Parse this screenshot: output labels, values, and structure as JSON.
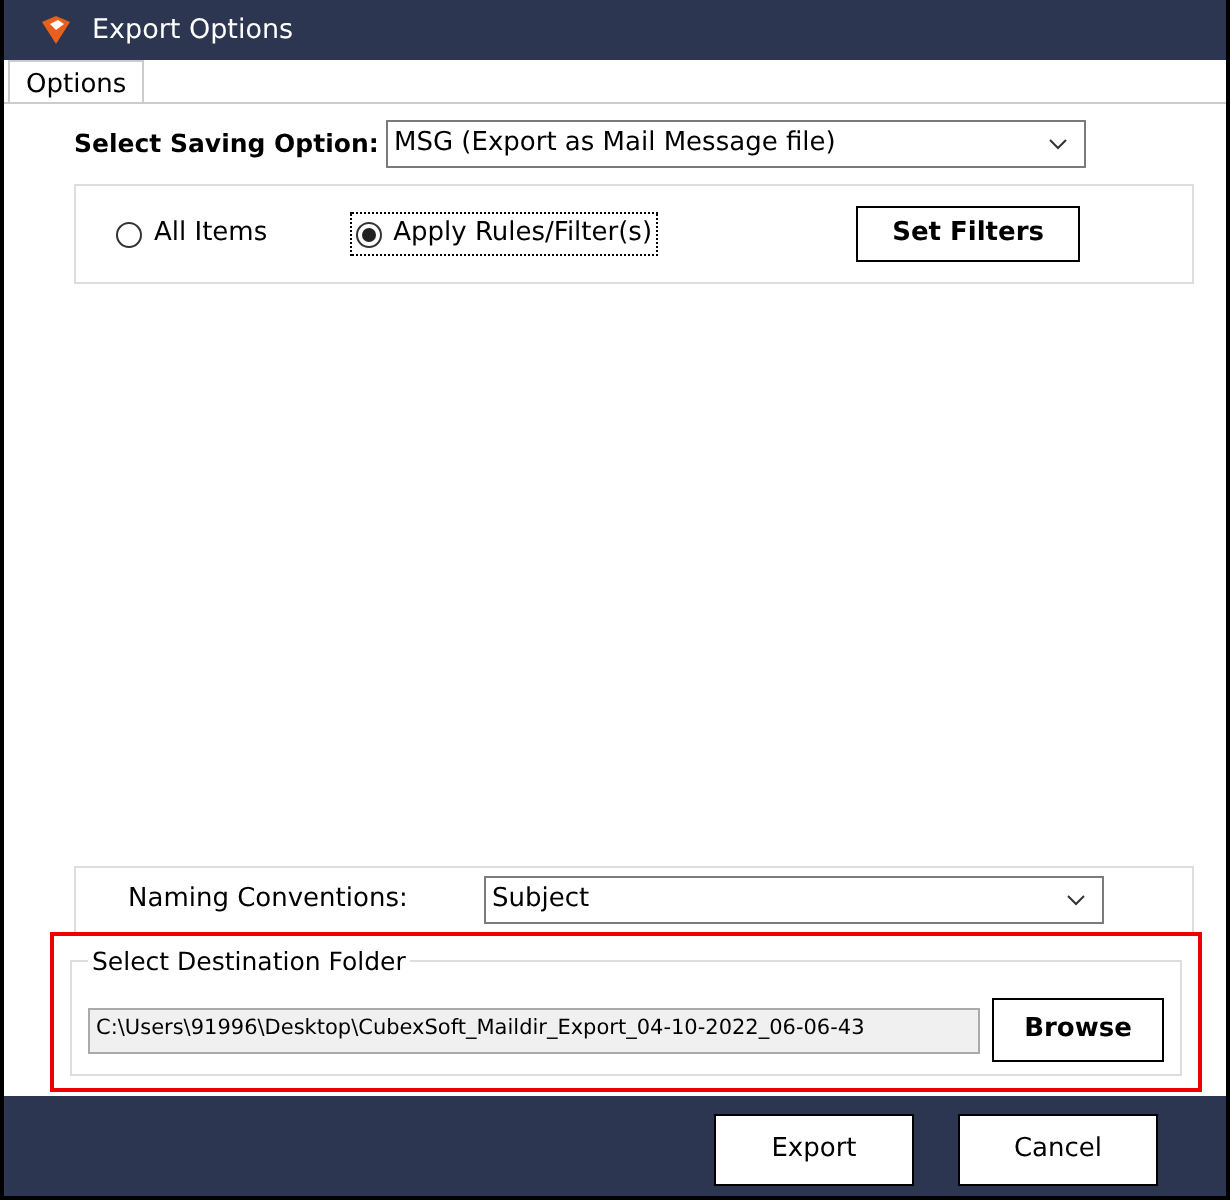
{
  "window": {
    "title": "Export Options"
  },
  "tabs": [
    {
      "label": "Options",
      "selected": true
    }
  ],
  "saving_option": {
    "label": "Select Saving Option:",
    "value": "MSG (Export as Mail Message file)"
  },
  "scope": [
    {
      "label": "All Items",
      "selected": false
    },
    {
      "label": "Apply Rules/Filter(s)",
      "selected": true
    }
  ],
  "set_filters_button": "Set Filters",
  "naming": {
    "label": "Naming Conventions:",
    "value": "Subject"
  },
  "destination": {
    "title": "Select Destination Folder",
    "path": "C:\\Users\\91996\\Desktop\\CubexSoft_Maildir_Export_04-10-2022_06-06-43",
    "browse_button": "Browse"
  },
  "buttons": [
    "Export",
    "Cancel"
  ]
}
